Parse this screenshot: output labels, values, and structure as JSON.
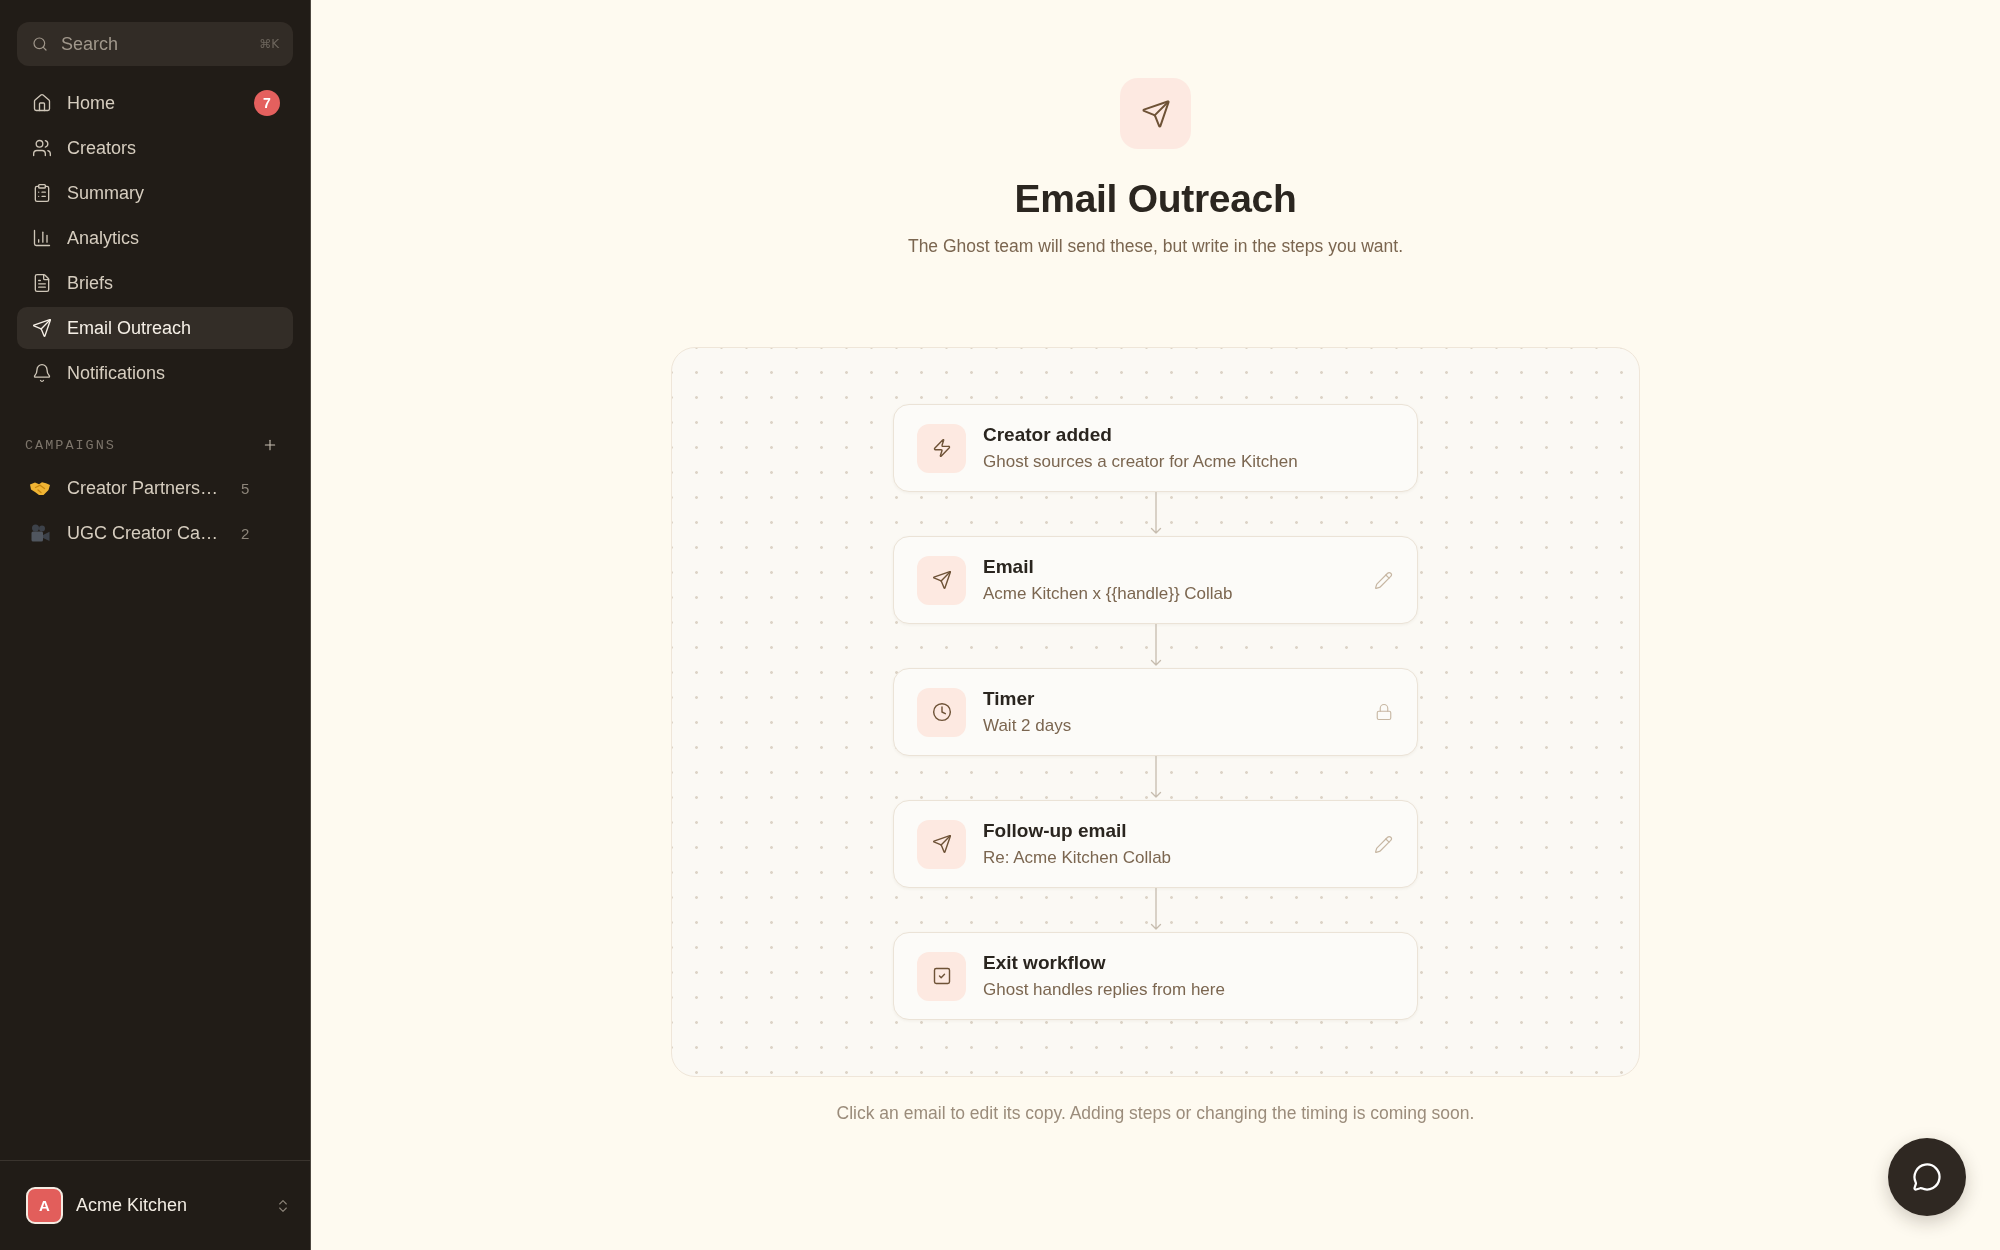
{
  "sidebar": {
    "search": {
      "placeholder": "Search",
      "shortcut": "⌘K"
    },
    "nav": [
      {
        "label": "Home",
        "badge": "7",
        "selected": false
      },
      {
        "label": "Creators",
        "selected": false
      },
      {
        "label": "Summary",
        "selected": false
      },
      {
        "label": "Analytics",
        "selected": false
      },
      {
        "label": "Briefs",
        "selected": false
      },
      {
        "label": "Email Outreach",
        "selected": true
      },
      {
        "label": "Notifications",
        "selected": false
      }
    ],
    "campaigns": {
      "heading": "CAMPAIGNS",
      "items": [
        {
          "name": "Creator Partners…",
          "count": "5",
          "selected": false
        },
        {
          "name": "UGC Creator Ca…",
          "count": "2",
          "selected": false
        }
      ]
    },
    "account": {
      "initial": "A",
      "name": "Acme Kitchen"
    }
  },
  "header": {
    "title": "Email Outreach",
    "subtitle": "The Ghost team will send these, but write in the steps you want."
  },
  "workflow": {
    "steps": [
      {
        "kind": "trigger",
        "title": "Creator added",
        "subtitle": "Ghost sources a creator for Acme Kitchen",
        "editable": false,
        "locked": false
      },
      {
        "kind": "email",
        "title": "Email",
        "subtitle": "Acme Kitchen x {{handle}} Collab",
        "editable": true,
        "locked": false
      },
      {
        "kind": "timer",
        "title": "Timer",
        "subtitle": "Wait 2 days",
        "editable": false,
        "locked": true
      },
      {
        "kind": "email",
        "title": "Follow-up email",
        "subtitle": "Re: Acme Kitchen Collab",
        "editable": true,
        "locked": false
      },
      {
        "kind": "exit",
        "title": "Exit workflow",
        "subtitle": "Ghost handles replies from here",
        "editable": false,
        "locked": false
      }
    ]
  },
  "caption": "Click an email to edit its copy. Adding steps or changing the timing is coming soon."
}
